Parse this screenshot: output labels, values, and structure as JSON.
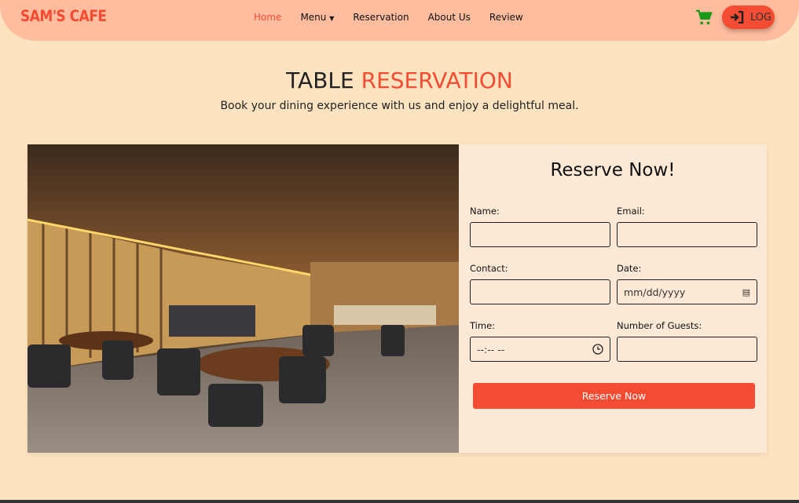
{
  "nav": {
    "logo": "SAM'S CAFE",
    "links": [
      "Home",
      "Menu",
      "Reservation",
      "About Us",
      "Review"
    ],
    "active": "Home",
    "login_label": "LOG",
    "accent_color": "#f44b33",
    "cart_color": "#1a9a1a"
  },
  "hero": {
    "title_part1": "TABLE",
    "title_part2": "RESERVATION",
    "subtitle": "Book your dining experience with us and enjoy a delightful meal."
  },
  "form": {
    "title": "Reserve Now!",
    "fields": [
      {
        "label": "Name:",
        "value": ""
      },
      {
        "label": "Email:",
        "value": ""
      },
      {
        "label": "Contact:",
        "value": ""
      },
      {
        "label": "Date:",
        "placeholder": "mm/dd/yyyy"
      },
      {
        "label": "Time:",
        "placeholder": "--:-- --"
      },
      {
        "label": "Number of Guests:",
        "value": ""
      }
    ],
    "submit": "Reserve Now"
  }
}
